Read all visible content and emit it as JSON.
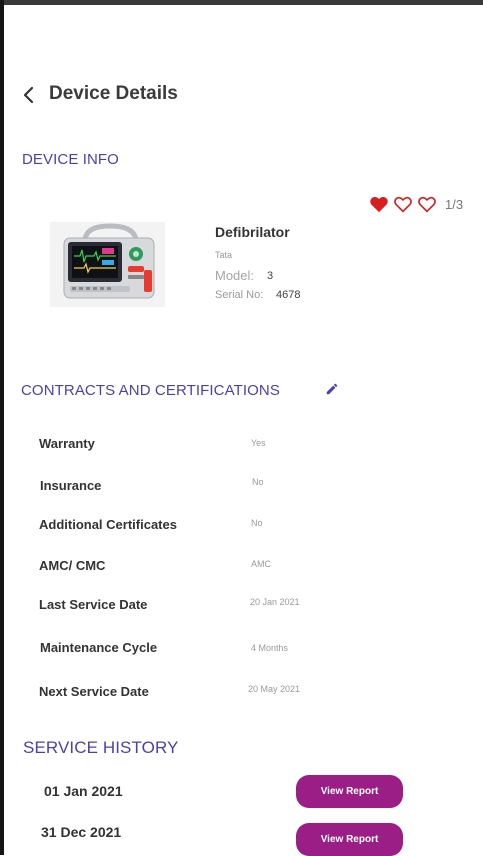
{
  "header": {
    "title": "Device Details"
  },
  "device_info": {
    "heading": "DEVICE INFO",
    "page_counter": "1/3",
    "name": "Defibrilator",
    "brand": "Tata",
    "model_label": "Model:",
    "model_value": "3",
    "serial_label": "Serial No:",
    "serial_value": "4678"
  },
  "contracts": {
    "heading": "CONTRACTS AND CERTIFICATIONS",
    "rows": [
      {
        "label": "Warranty",
        "value": "Yes"
      },
      {
        "label": "Insurance",
        "value": "No"
      },
      {
        "label": "Additional Certificates",
        "value": "No"
      },
      {
        "label": "AMC/ CMC",
        "value": "AMC"
      },
      {
        "label": "Last Service Date",
        "value": "20 Jan 2021"
      },
      {
        "label": "Maintenance Cycle",
        "value": "4 Months"
      },
      {
        "label": "Next Service Date",
        "value": "20 May 2021"
      }
    ]
  },
  "service_history": {
    "heading": "SERVICE HISTORY",
    "items": [
      {
        "date": "01 Jan 2021",
        "button_label": "View Report"
      },
      {
        "date": "31 Dec 2021",
        "button_label": "View Report"
      }
    ]
  },
  "colors": {
    "accent": "#4c3fb0",
    "heart": "#d81e1e",
    "report_button": "#9a1e86"
  },
  "icons": {
    "back": "chevron-left-icon",
    "favorite_filled": "heart-filled-icon",
    "favorite_outline": "heart-outline-icon",
    "edit": "pencil-icon"
  }
}
